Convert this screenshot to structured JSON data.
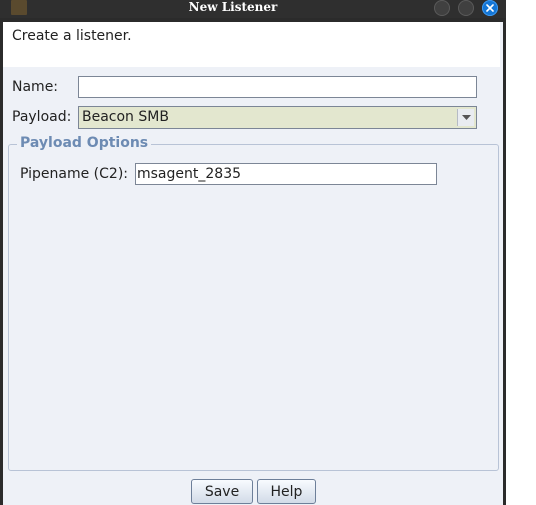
{
  "window": {
    "title": "New Listener",
    "banner": "Create a listener."
  },
  "form": {
    "name_label": "Name:",
    "name_value": "",
    "payload_label": "Payload:",
    "payload_selected": "Beacon SMB"
  },
  "payload_options": {
    "title": "Payload Options",
    "pipename_label": "Pipename (C2):",
    "pipename_value": "msagent_2835"
  },
  "buttons": {
    "save": "Save",
    "help": "Help"
  },
  "colors": {
    "accent": "#1476d6",
    "group_title": "#6d8bb3",
    "dialog_bg": "#eef1f7",
    "select_bg": "#e3e7cf"
  },
  "icons": {
    "window": "app-icon",
    "minimize": "circle-button-icon",
    "maximize": "circle-button-icon",
    "close": "close-icon",
    "dropdown": "chevron-down-icon"
  }
}
